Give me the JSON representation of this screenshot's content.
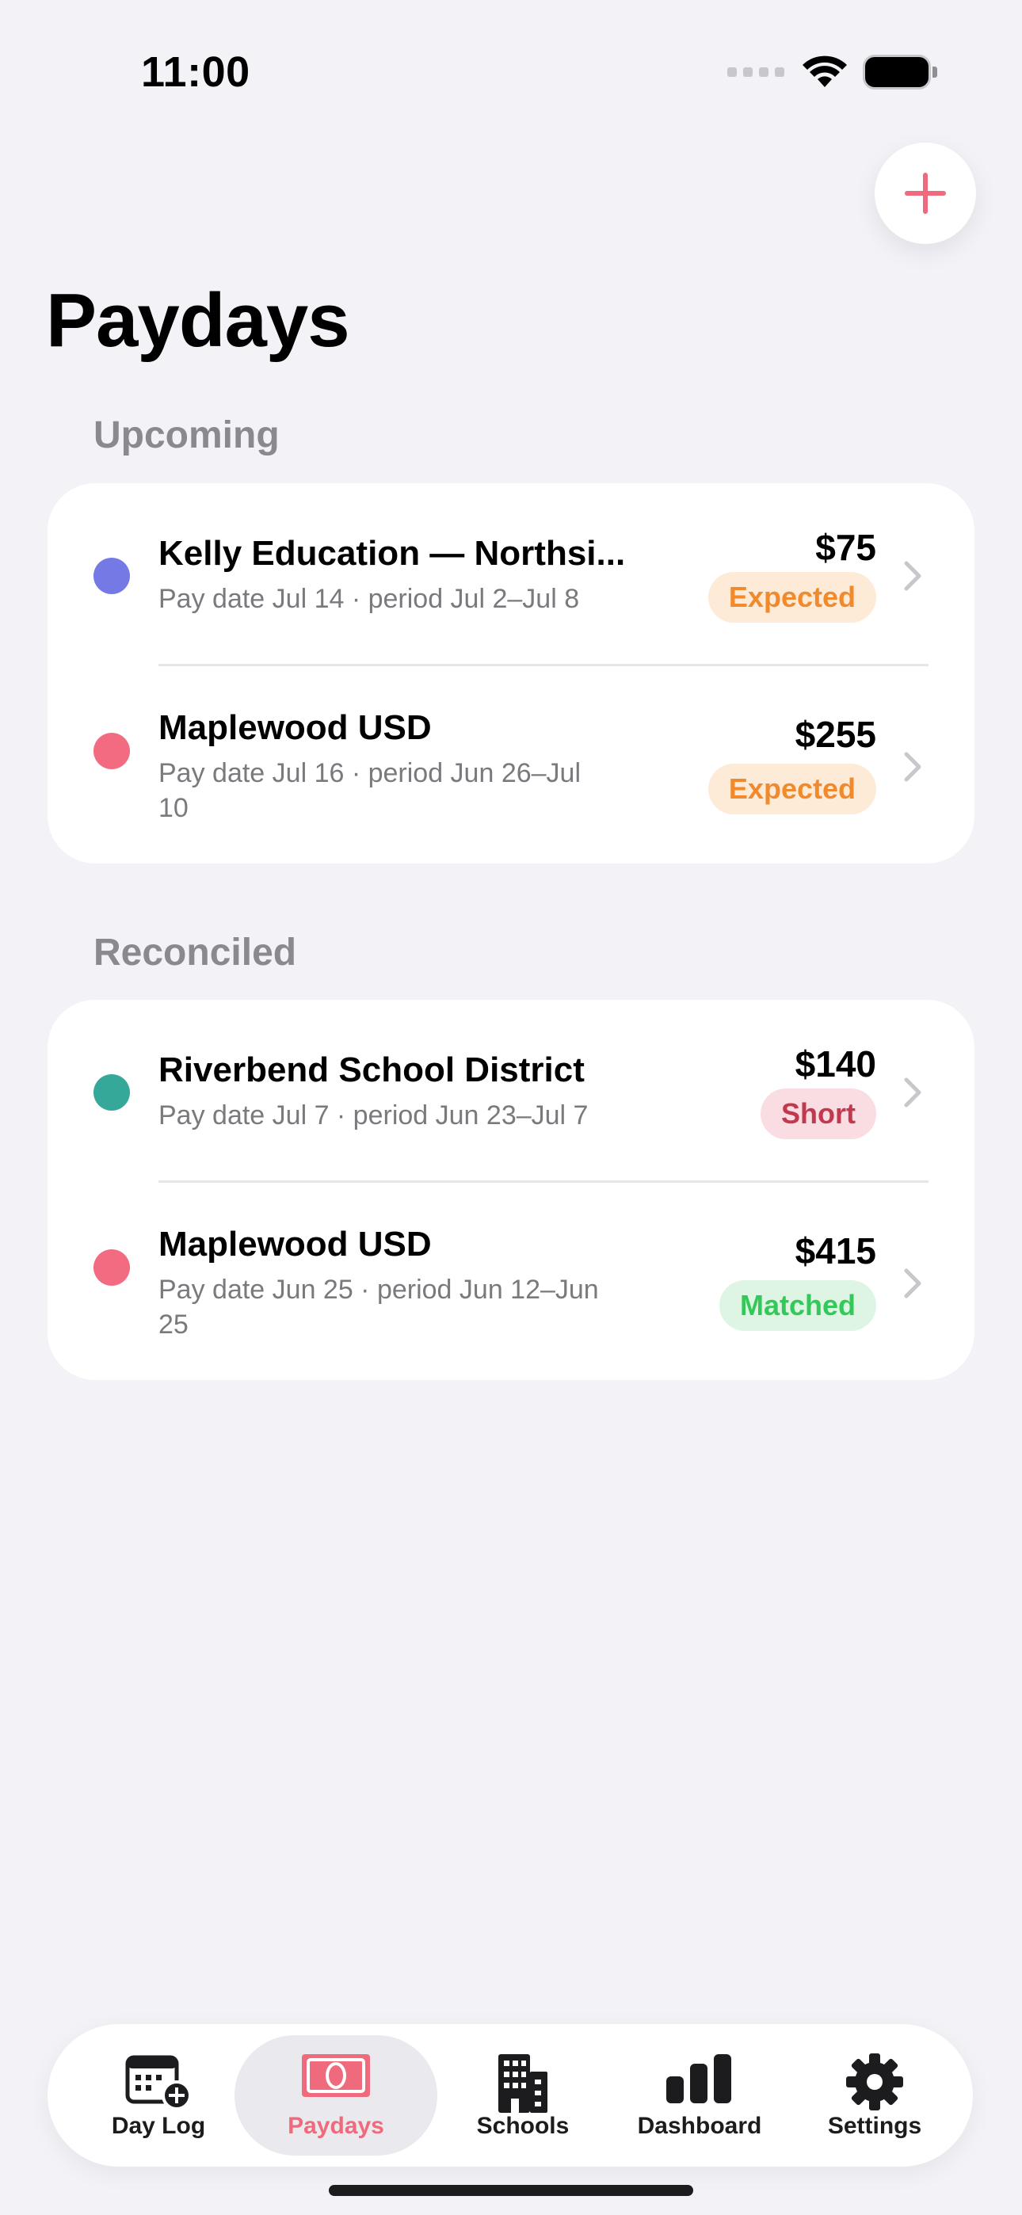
{
  "status_bar": {
    "time": "11:00"
  },
  "page": {
    "title": "Paydays"
  },
  "actions": {
    "add_icon": "plus-icon"
  },
  "colors": {
    "accent": "#EE6A7C",
    "expected_bg": "#FDEBD8",
    "expected_fg": "#F08A2C",
    "short_bg": "#F9DDE2",
    "short_fg": "#C0394E",
    "matched_bg": "#DDF5E2",
    "matched_fg": "#34C759"
  },
  "sections": [
    {
      "header": "Upcoming",
      "rows": [
        {
          "title": "Kelly Education — Northsi...",
          "subtitle": "Pay date Jul 14 · period Jul 2–Jul 8",
          "amount": "$75",
          "status": "Expected",
          "dot_color": "#7479E6"
        },
        {
          "title": "Maplewood USD",
          "subtitle": "Pay date Jul 16 · period Jun 26–Jul 10",
          "amount": "$255",
          "status": "Expected",
          "dot_color": "#F26B80"
        }
      ]
    },
    {
      "header": "Reconciled",
      "rows": [
        {
          "title": "Riverbend School District",
          "subtitle": "Pay date Jul 7 · period Jun 23–Jul 7",
          "amount": "$140",
          "status": "Short",
          "dot_color": "#36A89A"
        },
        {
          "title": "Maplewood USD",
          "subtitle": "Pay date Jun 25 · period Jun 12–Jun 25",
          "amount": "$415",
          "status": "Matched",
          "dot_color": "#F26B80"
        }
      ]
    }
  ],
  "tabbar": {
    "tabs": [
      {
        "label": "Day Log",
        "icon": "calendar-plus-icon",
        "active": false
      },
      {
        "label": "Paydays",
        "icon": "banknote-icon",
        "active": true
      },
      {
        "label": "Schools",
        "icon": "building-icon",
        "active": false
      },
      {
        "label": "Dashboard",
        "icon": "bar-chart-icon",
        "active": false
      },
      {
        "label": "Settings",
        "icon": "gear-icon",
        "active": false
      }
    ]
  }
}
